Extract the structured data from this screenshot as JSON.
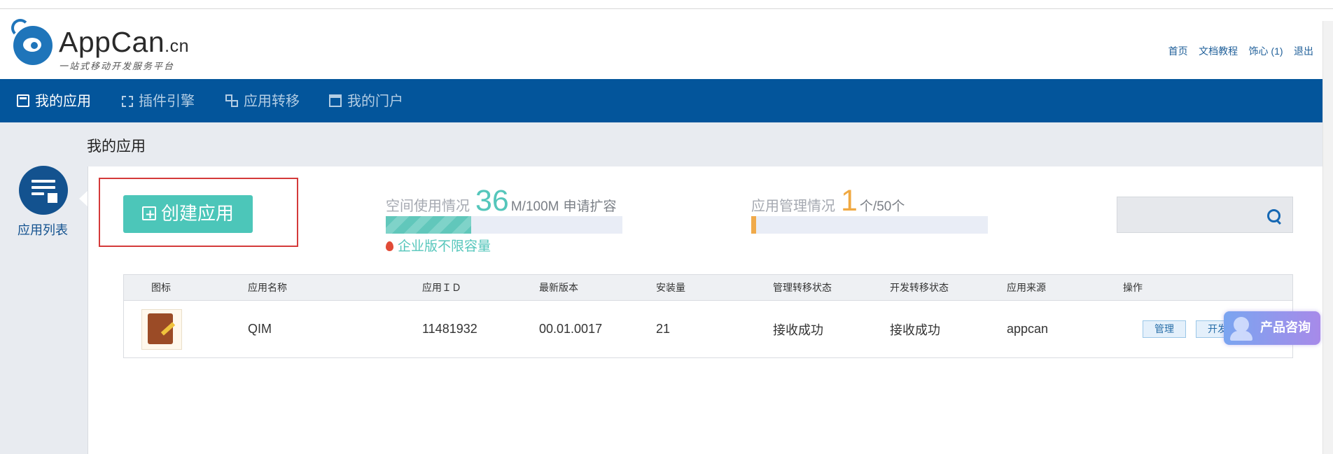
{
  "logo": {
    "word": "AppCan",
    "suffix": ".cn",
    "slogan": "一站式移动开发服务平台"
  },
  "top_links": {
    "home": "首页",
    "docs": "文档教程",
    "user": "饰心 (1)",
    "logout": "退出"
  },
  "nav": {
    "items": [
      {
        "label": "我的应用",
        "icon": "app-icon",
        "active": true
      },
      {
        "label": "插件引擎",
        "icon": "plugin-icon"
      },
      {
        "label": "应用转移",
        "icon": "transfer-icon"
      },
      {
        "label": "我的门户",
        "icon": "portal-icon"
      }
    ]
  },
  "page": {
    "title": "我的应用"
  },
  "sidebar": {
    "label": "应用列表",
    "icon": "list-icon"
  },
  "create_button": {
    "label": "创建应用"
  },
  "space_usage": {
    "label": "空间使用情况",
    "used": "36",
    "unit_total": "M/100M",
    "apply": "申请扩容",
    "fraction": 0.36
  },
  "app_usage": {
    "label": "应用管理情况",
    "used": "1",
    "unit": "个",
    "total": "/50个",
    "fraction": 0.02
  },
  "enterprise_note": "企业版不限容量",
  "search": {
    "placeholder": ""
  },
  "table": {
    "headers": [
      "图标",
      "应用名称",
      "应用ＩＤ",
      "最新版本",
      "安装量",
      "管理转移状态",
      "开发转移状态",
      "应用来源",
      "操作"
    ],
    "rows": [
      {
        "name": "QIM",
        "id": "11481932",
        "version": "00.01.0017",
        "installs": "21",
        "manage_status": "接收成功",
        "dev_status": "接收成功",
        "source": "appcan",
        "actions": [
          "管理",
          "开发"
        ]
      }
    ]
  },
  "consult": {
    "label": "产品咨询"
  },
  "colors": {
    "nav": "#03559b",
    "teal": "#4cc6b9",
    "orange": "#f0a942",
    "highlight": "#d43a3a"
  }
}
